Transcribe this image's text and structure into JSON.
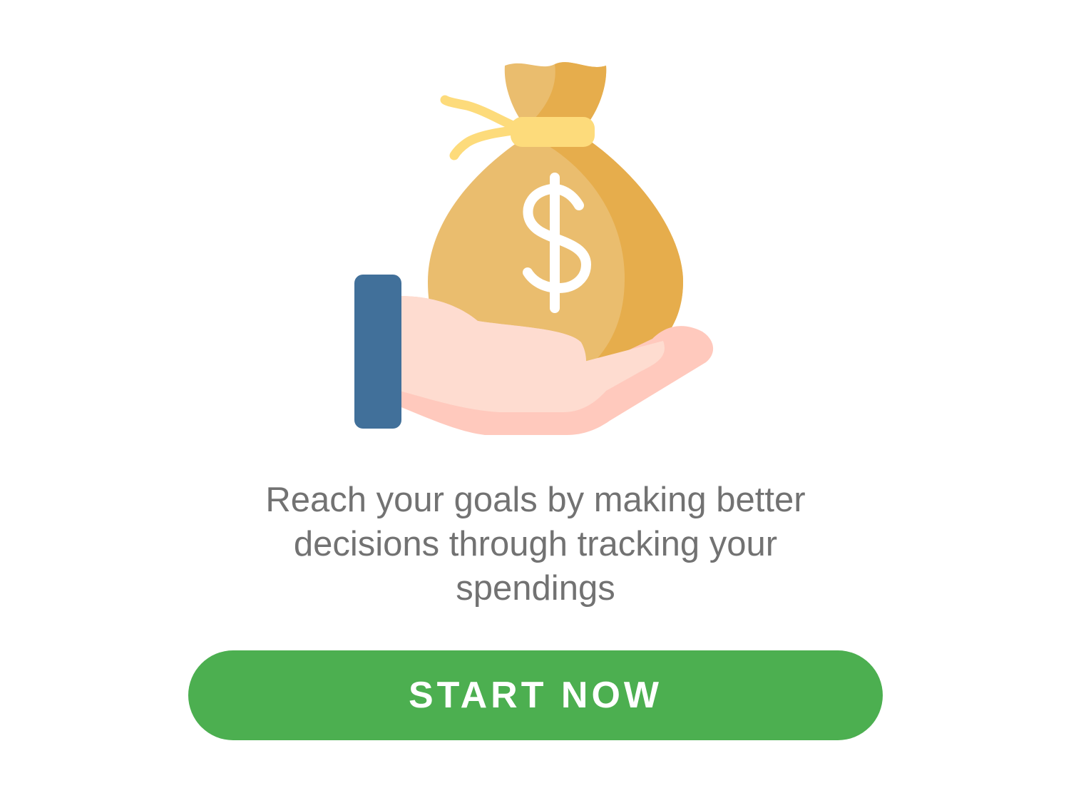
{
  "onboarding": {
    "illustration_icon": "hand-holding-money-bag-icon",
    "tagline": "Reach your goals by making better decisions through tracking your spendings",
    "cta_label": "START NOW"
  },
  "colors": {
    "background": "#ffffff",
    "text": "#727272",
    "button": "#4caf50",
    "button_text": "#ffffff",
    "bag_light": "#eabd6e",
    "bag_dark": "#e6ad4c",
    "bag_tie": "#fddb7b",
    "sleeve": "#41709a",
    "hand_light": "#fedcd0",
    "hand_shadow": "#ffc9bd"
  }
}
